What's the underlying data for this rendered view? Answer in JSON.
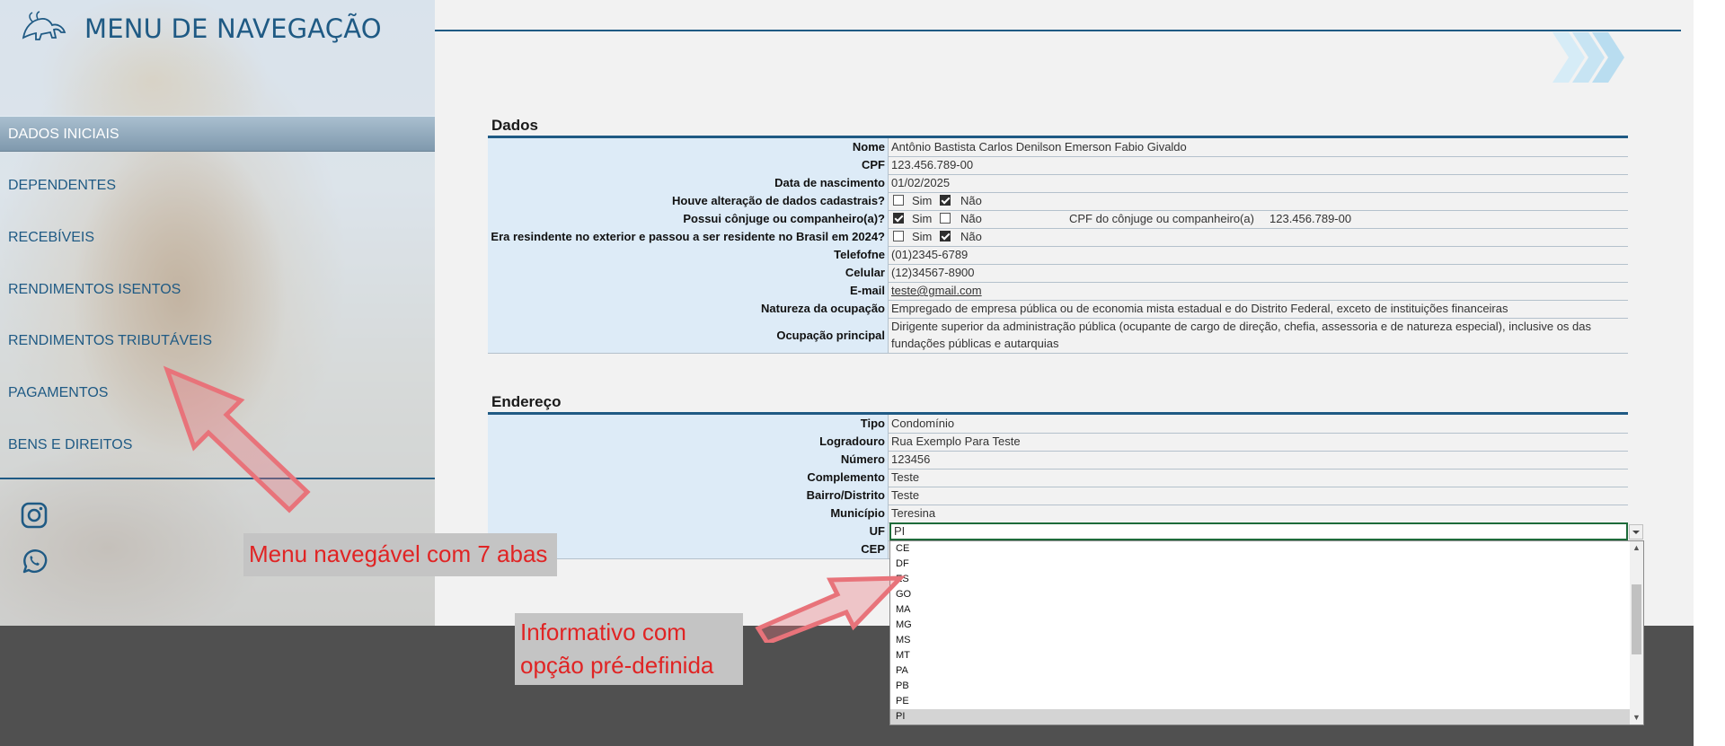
{
  "sidebar": {
    "title": "MENU DE NAVEGAÇÃO",
    "logo_icon": "lion-logo-icon",
    "items": [
      {
        "label": "DADOS INICIAIS",
        "active": true
      },
      {
        "label": "DEPENDENTES"
      },
      {
        "label": "RECEBÍVEIS"
      },
      {
        "label": "RENDIMENTOS ISENTOS"
      },
      {
        "label": "RENDIMENTOS TRIBUTÁVEIS"
      },
      {
        "label": "PAGAMENTOS"
      },
      {
        "label": "BENS E DIREITOS"
      }
    ],
    "social": [
      {
        "icon": "instagram-icon"
      },
      {
        "icon": "whatsapp-icon"
      }
    ]
  },
  "dados": {
    "title": "Dados",
    "rows": {
      "nome": {
        "label": "Nome",
        "value": "Antônio Bastista Carlos Denilson Emerson Fabio Givaldo"
      },
      "cpf": {
        "label": "CPF",
        "value": "123.456.789-00"
      },
      "nascimento": {
        "label": "Data de nascimento",
        "value": "01/02/2025"
      },
      "alteracao": {
        "label": "Houve alteração de dados cadastrais?",
        "sim": "Sim",
        "nao": "Não",
        "sim_checked": false,
        "nao_checked": true
      },
      "conjuge": {
        "label": "Possui cônjuge ou companheiro(a)?",
        "sim": "Sim",
        "nao": "Não",
        "sim_checked": true,
        "nao_checked": false,
        "cpf_label": "CPF do cônjuge ou companheiro(a)",
        "cpf_value": "123.456.789-00"
      },
      "exterior": {
        "label": "Era resindente no exterior e passou a ser residente no Brasil em 2024?",
        "sim": "Sim",
        "nao": "Não",
        "sim_checked": false,
        "nao_checked": true
      },
      "telefone": {
        "label": "Telefofne",
        "value": "(01)2345-6789"
      },
      "celular": {
        "label": "Celular",
        "value": "(12)34567-8900"
      },
      "email": {
        "label": "E-mail",
        "value": "teste@gmail.com"
      },
      "natureza": {
        "label": "Natureza da ocupação",
        "value": "Empregado de empresa pública ou de economia mista estadual e do Distrito Federal, exceto de instituições financeiras"
      },
      "ocupacao": {
        "label": "Ocupação principal",
        "value": "Dirigente superior da administração pública (ocupante de cargo de direção, chefia, assessoria e de natureza especial), inclusive os das fundações públicas e autarquias"
      }
    }
  },
  "endereco": {
    "title": "Endereço",
    "rows": {
      "tipo": {
        "label": "Tipo",
        "value": "Condomínio"
      },
      "logradouro": {
        "label": "Logradouro",
        "value": "Rua Exemplo Para Teste"
      },
      "numero": {
        "label": "Número",
        "value": "123456"
      },
      "complemento": {
        "label": "Complemento",
        "value": "Teste"
      },
      "bairro": {
        "label": "Bairro/Distrito",
        "value": "Teste"
      },
      "municipio": {
        "label": "Município",
        "value": "Teresina"
      },
      "uf": {
        "label": "UF",
        "value": "PI"
      },
      "cep": {
        "label": "CEP"
      }
    },
    "uf_options": [
      "CE",
      "DF",
      "ES",
      "GO",
      "MA",
      "MG",
      "MS",
      "MT",
      "PA",
      "PB",
      "PE",
      "PI"
    ],
    "uf_selected": "PI"
  },
  "annotations": {
    "menu_note": "Menu navegável com 7 abas",
    "info_note_line1": "Informativo com",
    "info_note_line2": "opção pré-definida",
    "arrow_color": "#e8737a",
    "text_color": "#e02424"
  },
  "colors": {
    "accent": "#1f5a84",
    "label_bg": "#ddebf7",
    "selection_border": "#1e6b3a"
  },
  "header_icon": "chevron-forward-icon"
}
